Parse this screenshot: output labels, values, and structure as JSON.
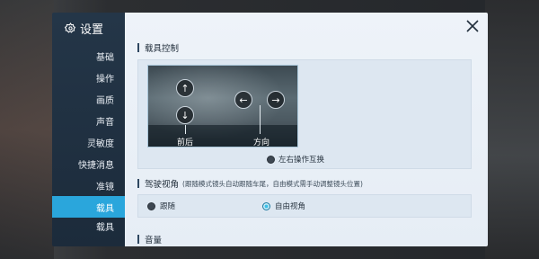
{
  "sidebar": {
    "title": "设置",
    "items": [
      {
        "label": "基础",
        "active": false
      },
      {
        "label": "操作",
        "active": false
      },
      {
        "label": "画质",
        "active": false
      },
      {
        "label": "声音",
        "active": false
      },
      {
        "label": "灵敏度",
        "active": false
      },
      {
        "label": "快捷消息",
        "active": false
      },
      {
        "label": "准镜",
        "active": false
      },
      {
        "label": "载具",
        "active": true
      },
      {
        "label": "载具",
        "active": false
      }
    ]
  },
  "vehicle_control": {
    "title": "载具控制",
    "label_front_back": "前后",
    "label_direction": "方向",
    "arrows": {
      "up": "↑",
      "down": "↓",
      "left": "←",
      "right": "→"
    },
    "swap_option": "左右操作互换",
    "swap_selected": false
  },
  "camera": {
    "title": "驾驶视角",
    "subtitle": "(跟随模式镜头自动跟随车尾，自由模式需手动调整镜头位置)",
    "options": [
      {
        "label": "跟随",
        "selected": false
      },
      {
        "label": "自由视角",
        "selected": true
      }
    ]
  },
  "next_section": {
    "title": "音量"
  },
  "colors": {
    "accent": "#2aa6dc",
    "sidebar": "#243648",
    "content": "#eef3f9"
  },
  "icons": {
    "settings": "gear-icon",
    "close": "close-icon"
  }
}
